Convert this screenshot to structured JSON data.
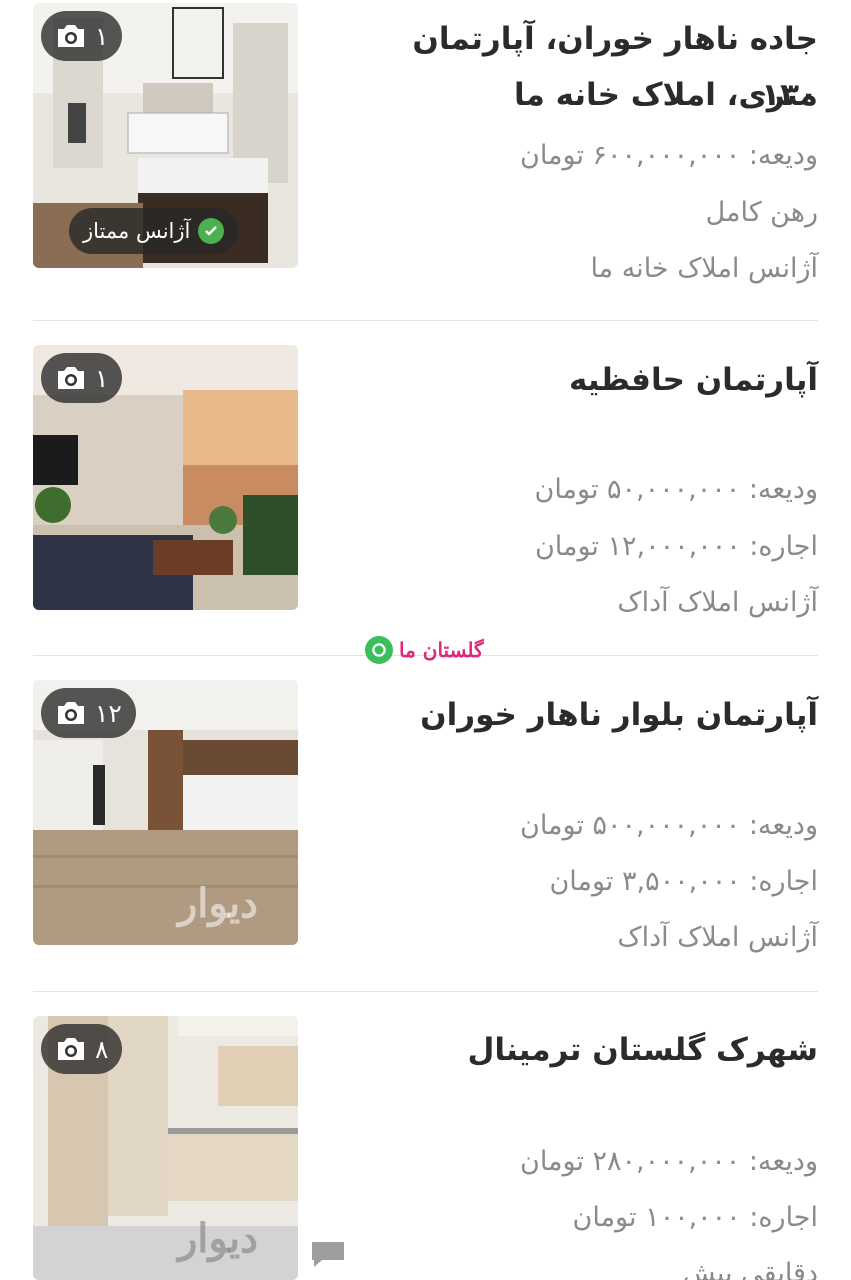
{
  "listings": [
    {
      "title_line1": "جاده ناهار خوران، آپارتمان ۱۳۰",
      "title_line2": "متری، املاک خانه ما",
      "line1": "ودیعه: ۶۰۰,۰۰۰,۰۰۰ تومان",
      "line2": "رهن کامل",
      "line3": "آژانس املاک خانه ما",
      "photo_count": "۱",
      "badge": "آژانس ممتاز"
    },
    {
      "title_line1": "آپارتمان حافظیه",
      "line1": "ودیعه: ۵۰,۰۰۰,۰۰۰ تومان",
      "line2": "اجاره: ۱۲,۰۰۰,۰۰۰ تومان",
      "line3": "آژانس املاک آداک",
      "photo_count": "۱"
    },
    {
      "title_line1": "آپارتمان بلوار ناهار خوران",
      "line1": "ودیعه: ۵۰۰,۰۰۰,۰۰۰ تومان",
      "line2": "اجاره: ۳,۵۰۰,۰۰۰ تومان",
      "line3": "آژانس املاک آداک",
      "photo_count": "۱۲",
      "watermark": "دیوار"
    },
    {
      "title_line1": "شهرک گلستان ترمینال",
      "line1": "ودیعه: ۲۸۰,۰۰۰,۰۰۰ تومان",
      "line2": "اجاره: ۱۰۰,۰۰۰ تومان",
      "line3": "دقایقی پیش",
      "photo_count": "۸",
      "watermark": "دیوار"
    }
  ],
  "overlay_logo": {
    "text": "گلستان ما",
    "color": "#e0287a",
    "mark_color": "#3bbf5a"
  },
  "colors": {
    "badge_check": "#4caf50",
    "divider": "#e3e3e3",
    "secondary_text": "#8a8a8a"
  },
  "icons": [
    "camera-icon",
    "verified-check-icon",
    "chat-bubble-icon"
  ]
}
